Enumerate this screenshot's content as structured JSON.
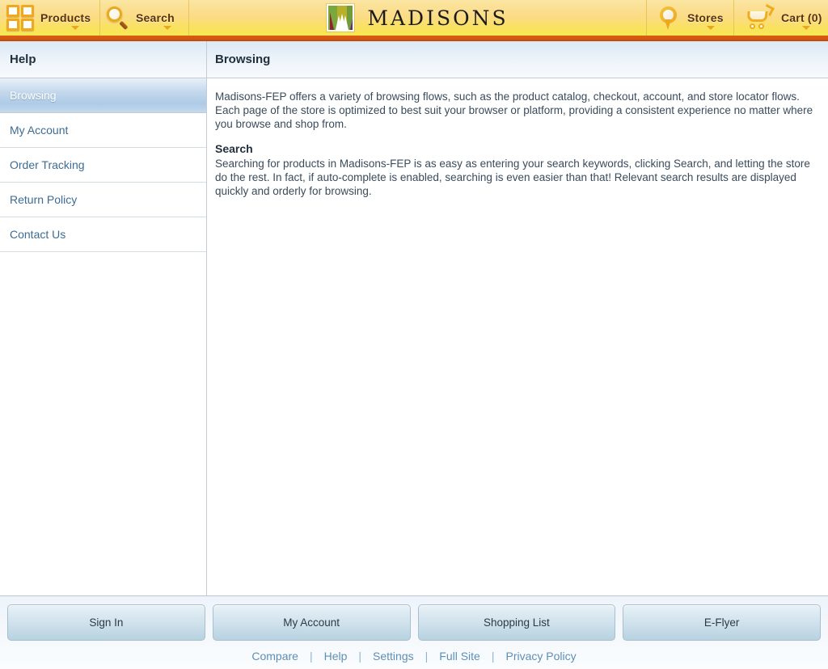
{
  "header": {
    "products": {
      "label": "Products",
      "icon": "grid-icon",
      "caret": "chevron-down-icon"
    },
    "search": {
      "label": "Search",
      "icon": "magnifier-icon",
      "caret": "chevron-down-icon"
    },
    "brand": {
      "name": "MADISONS",
      "logo": "madisons-m-logo"
    },
    "stores": {
      "label": "Stores",
      "icon": "map-pin-icon",
      "caret": "chevron-down-icon"
    },
    "cart": {
      "label": "Cart (0)",
      "icon": "shopping-cart-icon",
      "caret": "chevron-down-icon",
      "count": 0
    }
  },
  "sidebar": {
    "title": "Help",
    "items": [
      {
        "label": "Browsing",
        "selected": true
      },
      {
        "label": "My Account",
        "selected": false
      },
      {
        "label": "Order Tracking",
        "selected": false
      },
      {
        "label": "Return Policy",
        "selected": false
      },
      {
        "label": "Contact Us",
        "selected": false
      }
    ]
  },
  "main": {
    "title": "Browsing",
    "intro": "Madisons-FEP offers a variety of browsing flows, such as the product catalog, checkout, account, and store locator flows. Each page of the store is optimized to best suit your browser or platform, providing a consistent experience no matter where you browse and shop from.",
    "section_heading": "Search",
    "section_body": "Searching for products in Madisons-FEP is as easy as entering your search keywords, clicking Search, and letting the store do the rest. In fact, if auto-complete is enabled, searching is even easier than that! Relevant search results are displayed quickly and orderly for browsing."
  },
  "footer": {
    "buttons": [
      {
        "label": "Sign In"
      },
      {
        "label": "My Account"
      },
      {
        "label": "Shopping List"
      },
      {
        "label": "E-Flyer"
      }
    ],
    "links": [
      {
        "label": "Compare"
      },
      {
        "label": "Help"
      },
      {
        "label": "Settings"
      },
      {
        "label": "Full Site"
      },
      {
        "label": "Privacy Policy"
      }
    ],
    "separator": "|"
  },
  "colors": {
    "header_yellow_top": "#fbe6a4",
    "header_yellow_bottom": "#f7e654",
    "header_rule_orange": "#d4590f",
    "panel_header_blue": "#dbe8f5",
    "link_blue": "#5d8fb5",
    "nav_link": "#3d6c92",
    "text_body": "#3a4b5c"
  }
}
